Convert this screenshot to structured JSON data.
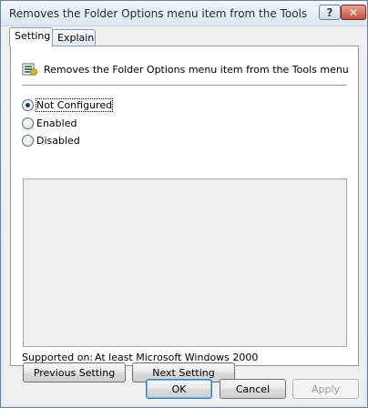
{
  "window": {
    "title": "Removes the Folder Options menu item from the Tools me...",
    "help_glyph": "?",
    "close_glyph": "✕"
  },
  "tabs": [
    {
      "label": "Setting",
      "active": true
    },
    {
      "label": "Explain",
      "active": false
    }
  ],
  "policy": {
    "icon": "policy-setting-icon",
    "title": "Removes the Folder Options menu item from the Tools menu"
  },
  "options": [
    {
      "label": "Not Configured",
      "selected": true
    },
    {
      "label": "Enabled",
      "selected": false
    },
    {
      "label": "Disabled",
      "selected": false
    }
  ],
  "supported": {
    "label": "Supported on:",
    "value": "At least Microsoft Windows 2000"
  },
  "buttons": {
    "previous": "Previous Setting",
    "next": "Next Setting",
    "ok": "OK",
    "cancel": "Cancel",
    "apply": "Apply"
  },
  "colors": {
    "title_gradient_top": "#f3f7fb",
    "close_button": "#c8513f",
    "default_button_border": "#3c7fb1"
  }
}
